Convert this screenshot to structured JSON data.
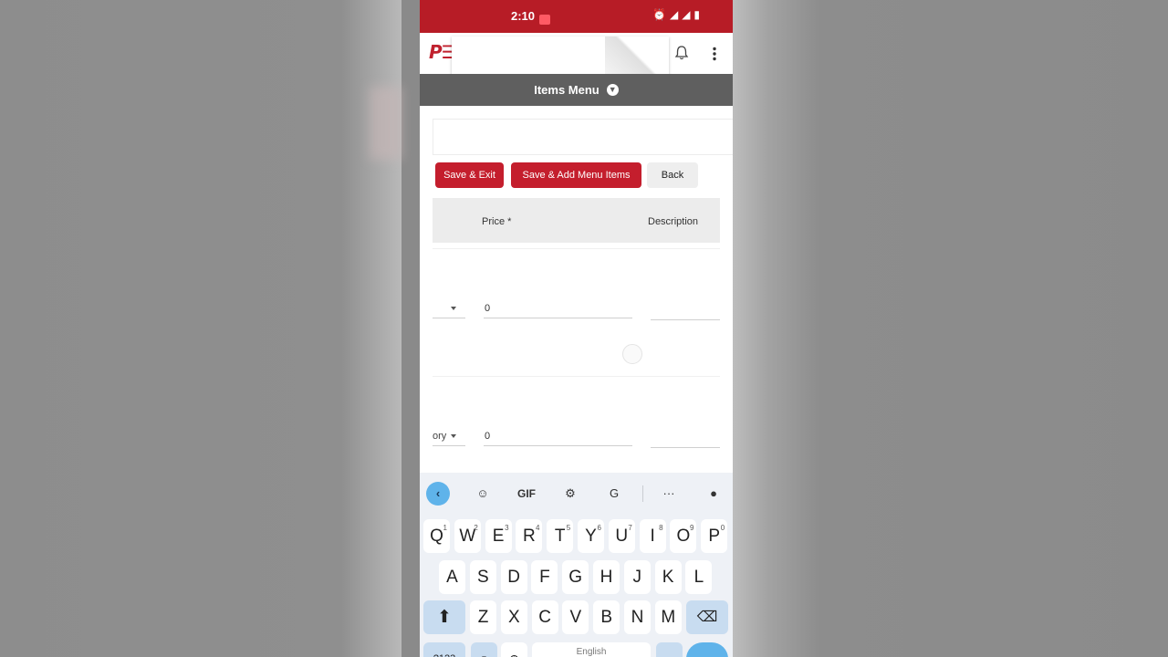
{
  "status_bar": {
    "time": "2:10"
  },
  "app_header": {
    "logo": "P☰"
  },
  "items_menu": {
    "title": "Items Menu"
  },
  "actions": {
    "save_exit": "Save & Exit",
    "save_add": "Save & Add Menu Items",
    "back": "Back"
  },
  "table": {
    "columns": {
      "price": "Price *",
      "description": "Description"
    },
    "rows": [
      {
        "category": "",
        "price": "0",
        "description": ""
      },
      {
        "category": "ory",
        "price": "0",
        "description": ""
      }
    ]
  },
  "keyboard": {
    "toolbar": [
      "back-icon",
      "sticker-icon",
      "GIF",
      "gear-icon",
      "translate-icon",
      "more-icon",
      "mic-icon"
    ],
    "gif_label": "GIF",
    "more_label": "···",
    "row1": [
      "Q",
      "W",
      "E",
      "R",
      "T",
      "Y",
      "U",
      "I",
      "O",
      "P"
    ],
    "row1_hints": [
      "1",
      "2",
      "3",
      "4",
      "5",
      "6",
      "7",
      "8",
      "9",
      "0"
    ],
    "row2": [
      "A",
      "S",
      "D",
      "F",
      "G",
      "H",
      "J",
      "K",
      "L"
    ],
    "row3": [
      "Z",
      "X",
      "C",
      "V",
      "B",
      "N",
      "M"
    ],
    "symbols_label": "?123",
    "space_label": "English"
  },
  "colors": {
    "brand_red": "#c41e2d",
    "status_red": "#b71c26",
    "menu_bar": "#5f5f5f"
  }
}
